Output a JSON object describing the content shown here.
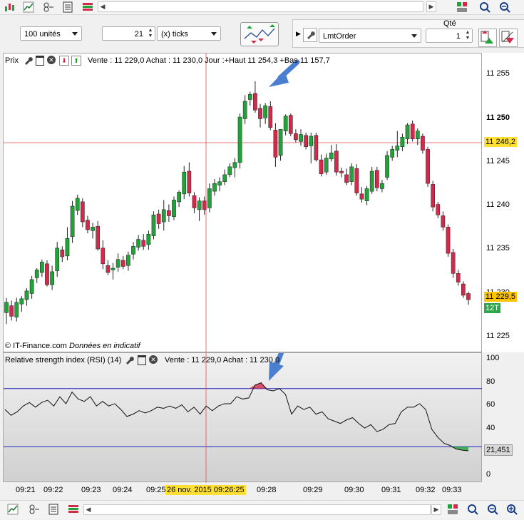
{
  "toolbar": {
    "quantity_label": "100 unités",
    "period_value": "21",
    "period_unit": "(x) ticks",
    "order_type": "LmtOrder",
    "qty_header": "Qté",
    "qty_value": "1"
  },
  "price_panel": {
    "title": "Prix",
    "info": "Vente : 11 229,0 Achat : 11 230,0 Jour :+Haut 11 254,3 +Bas 11 157,7",
    "watermark_brand": "© IT-Finance.com",
    "watermark_note": "Données en indicatif",
    "y_ticks": [
      "11 255",
      "11 250",
      "11 245",
      "11 240",
      "11 235",
      "11 230",
      "11 225"
    ],
    "cursor_price_tag": "11 246,2",
    "last_price_tag": "11 229,5",
    "tick_count_tag": "12T"
  },
  "rsi_panel": {
    "title": "Relative strength index (RSI) (14)",
    "info": "Vente : 11 229,0 Achat : 11 230,0",
    "y_ticks": [
      "100",
      "80",
      "60",
      "40",
      "20",
      "0"
    ],
    "value_tag": "21,451"
  },
  "x_axis": {
    "ticks": [
      "09:21",
      "09:22",
      "09:23",
      "09:24",
      "09:25",
      "09:28",
      "09:29",
      "09:30",
      "09:31",
      "09:32",
      "09:33"
    ],
    "cursor_label": "26 nov. 2015 09:26:25"
  },
  "colors": {
    "up": "#22a33a",
    "down": "#d22a4a",
    "arrow": "#4a7fd0",
    "crosshair": "#e05050",
    "rsi_band": "#2020c0"
  },
  "chart_data": [
    {
      "type": "candlestick",
      "series": [
        {
          "name": "Prix",
          "values": [
            [
              11227.8,
              11229.5,
              11226.5,
              11229.0
            ],
            [
              11228.6,
              11229.2,
              11226.9,
              11227.4
            ],
            [
              11227.3,
              11229.5,
              11226.8,
              11229.0
            ],
            [
              11228.8,
              11229.7,
              11227.9,
              11229.4
            ],
            [
              11229.3,
              11230.6,
              11228.6,
              11230.3
            ],
            [
              11230.0,
              11232.0,
              11229.4,
              11231.6
            ],
            [
              11231.8,
              11232.9,
              11231.2,
              11232.7
            ],
            [
              11232.4,
              11233.9,
              11231.9,
              11233.6
            ],
            [
              11233.4,
              11233.8,
              11230.8,
              11231.0
            ],
            [
              11231.0,
              11233.2,
              11230.4,
              11232.5
            ],
            [
              11232.6,
              11235.9,
              11231.9,
              11235.2
            ],
            [
              11235.0,
              11235.4,
              11233.6,
              11234.2
            ],
            [
              11234.3,
              11237.6,
              11233.8,
              11236.3
            ],
            [
              11236.5,
              11240.6,
              11235.8,
              11240.0
            ],
            [
              11239.5,
              11241.3,
              11239.0,
              11240.9
            ],
            [
              11240.5,
              11240.9,
              11237.6,
              11238.2
            ],
            [
              11238.4,
              11238.9,
              11236.9,
              11237.3
            ],
            [
              11237.2,
              11238.1,
              11236.3,
              11237.6
            ],
            [
              11237.7,
              11238.3,
              11234.9,
              11235.1
            ],
            [
              11235.2,
              11236.1,
              11232.8,
              11233.4
            ],
            [
              11233.2,
              11233.8,
              11232.1,
              11232.4
            ],
            [
              11232.7,
              11233.5,
              11231.6,
              11232.9
            ],
            [
              11233.0,
              11234.6,
              11232.5,
              11233.9
            ],
            [
              11233.8,
              11234.3,
              11232.8,
              11233.1
            ],
            [
              11233.2,
              11234.8,
              11232.6,
              11234.4
            ],
            [
              11234.5,
              11235.9,
              11233.9,
              11235.4
            ],
            [
              11235.3,
              11236.7,
              11234.9,
              11236.2
            ],
            [
              11236.1,
              11236.8,
              11235.0,
              11235.4
            ],
            [
              11235.6,
              11237.2,
              11235.0,
              11236.8
            ],
            [
              11236.6,
              11239.4,
              11236.2,
              11239.0
            ],
            [
              11239.1,
              11239.6,
              11237.4,
              11238.0
            ],
            [
              11238.2,
              11240.7,
              11237.2,
              11239.6
            ],
            [
              11239.5,
              11240.2,
              11238.2,
              11238.9
            ],
            [
              11238.8,
              11241.1,
              11238.4,
              11240.7
            ],
            [
              11240.5,
              11241.8,
              11239.9,
              11241.6
            ],
            [
              11241.4,
              11244.6,
              11240.8,
              11243.9
            ],
            [
              11244.0,
              11245.0,
              11241.1,
              11241.5
            ],
            [
              11241.2,
              11241.6,
              11239.2,
              11239.8
            ],
            [
              11239.6,
              11241.0,
              11238.3,
              11240.6
            ],
            [
              11240.6,
              11241.1,
              11239.0,
              11239.6
            ],
            [
              11239.8,
              11242.6,
              11239.3,
              11242.0
            ],
            [
              11241.7,
              11243.1,
              11241.2,
              11242.6
            ],
            [
              11242.4,
              11243.3,
              11241.7,
              11242.8
            ],
            [
              11242.8,
              11244.2,
              11242.4,
              11243.6
            ],
            [
              11243.6,
              11244.9,
              11243.3,
              11244.5
            ],
            [
              11244.4,
              11245.5,
              11243.3,
              11245.0
            ],
            [
              11245.0,
              11250.6,
              11244.3,
              11250.2
            ],
            [
              11250.0,
              11252.7,
              11249.4,
              11252.0
            ],
            [
              11252.2,
              11253.1,
              11251.5,
              11252.8
            ],
            [
              11252.9,
              11254.3,
              11250.7,
              11251.0
            ],
            [
              11251.2,
              11251.7,
              11249.0,
              11250.0
            ],
            [
              11250.1,
              11251.8,
              11249.4,
              11251.5
            ],
            [
              11251.4,
              11252.0,
              11248.7,
              11249.0
            ],
            [
              11248.7,
              11249.5,
              11244.5,
              11245.6
            ],
            [
              11245.8,
              11248.2,
              11245.2,
              11248.8
            ],
            [
              11248.6,
              11250.5,
              11248.1,
              11250.3
            ],
            [
              11250.4,
              11250.6,
              11248.0,
              11248.3
            ],
            [
              11248.3,
              11248.8,
              11247.3,
              11247.6
            ],
            [
              11247.4,
              11248.8,
              11246.9,
              11248.2
            ],
            [
              11248.1,
              11248.4,
              11246.5,
              11246.8
            ],
            [
              11246.9,
              11248.4,
              11244.9,
              11248.0
            ],
            [
              11248.1,
              11248.4,
              11245.1,
              11245.3
            ],
            [
              11245.3,
              11245.9,
              11243.4,
              11243.7
            ],
            [
              11243.9,
              11246.0,
              11243.6,
              11245.5
            ],
            [
              11245.4,
              11247.0,
              11245.1,
              11246.1
            ],
            [
              11246.3,
              11247.1,
              11243.5,
              11243.9
            ],
            [
              11244.0,
              11244.4,
              11243.3,
              11243.8
            ],
            [
              11243.6,
              11244.3,
              11242.4,
              11242.7
            ],
            [
              11242.8,
              11244.9,
              11242.4,
              11244.5
            ],
            [
              11244.3,
              11244.8,
              11241.2,
              11241.5
            ],
            [
              11241.4,
              11242.2,
              11240.4,
              11240.8
            ],
            [
              11240.6,
              11242.3,
              11240.1,
              11242.0
            ],
            [
              11241.7,
              11244.5,
              11241.4,
              11244.0
            ],
            [
              11244.1,
              11244.5,
              11241.7,
              11242.1
            ],
            [
              11242.0,
              11243.0,
              11241.6,
              11242.6
            ],
            [
              11243.3,
              11246.3,
              11243.0,
              11245.8
            ],
            [
              11245.6,
              11246.9,
              11245.2,
              11246.5
            ],
            [
              11246.4,
              11248.6,
              11245.6,
              11246.9
            ],
            [
              11246.8,
              11248.3,
              11246.3,
              11247.9
            ],
            [
              11247.7,
              11249.5,
              11247.1,
              11249.3
            ],
            [
              11249.4,
              11249.8,
              11247.4,
              11247.7
            ],
            [
              11247.7,
              11248.9,
              11247.0,
              11248.6
            ],
            [
              11248.0,
              11248.3,
              11246.0,
              11246.4
            ],
            [
              11246.5,
              11246.8,
              11242.2,
              11242.6
            ],
            [
              11242.5,
              11242.9,
              11239.4,
              11239.9
            ],
            [
              11240.2,
              11240.5,
              11238.6,
              11239.0
            ],
            [
              11238.9,
              11239.4,
              11237.2,
              11237.6
            ],
            [
              11237.6,
              11237.9,
              11234.2,
              11234.6
            ],
            [
              11234.7,
              11235.1,
              11231.8,
              11232.3
            ],
            [
              11232.3,
              11232.7,
              11230.9,
              11231.3
            ],
            [
              11231.1,
              11231.4,
              11229.5,
              11229.8
            ],
            [
              11230.0,
              11230.2,
              11228.7,
              11229.3
            ]
          ]
        }
      ],
      "ylim": [
        11224,
        11256
      ]
    },
    {
      "type": "line",
      "series": [
        {
          "name": "Relative strength index (RSI) (14)",
          "values": [
            57,
            52,
            55,
            60,
            63,
            59,
            63,
            65,
            60,
            68,
            62,
            72,
            66,
            64,
            68,
            60,
            64,
            60,
            62,
            57,
            51,
            53,
            56,
            54,
            56,
            59,
            58,
            60,
            58,
            61,
            55,
            59,
            53,
            60,
            56,
            60,
            62,
            62,
            68,
            66,
            67,
            78,
            80,
            74,
            73,
            75,
            70,
            53,
            60,
            57,
            59,
            53,
            55,
            49,
            47,
            45,
            48,
            50,
            45,
            41,
            44,
            38,
            40,
            44,
            45,
            55,
            59,
            59,
            62,
            57,
            40,
            33,
            28,
            26,
            23,
            22,
            21.451
          ]
        }
      ],
      "bands": [
        75,
        25
      ],
      "ylim": [
        0,
        100
      ]
    }
  ]
}
